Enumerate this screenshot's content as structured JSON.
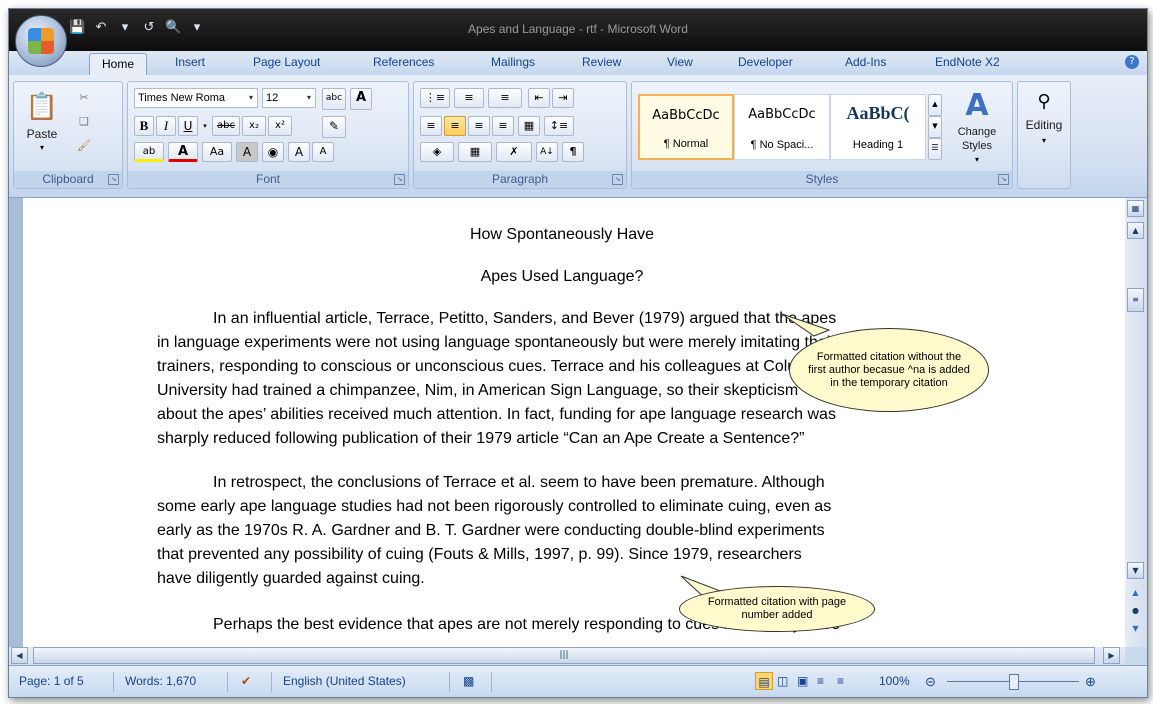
{
  "window": {
    "title": "Apes and Language - rtf - Microsoft Word",
    "quick_access_icons": [
      "save-icon",
      "undo-icon",
      "undo-dropdown-icon",
      "redo-icon",
      "print-preview-icon",
      "customize-qat-icon"
    ]
  },
  "tabs": [
    {
      "label": "Home",
      "active": true
    },
    {
      "label": "Insert"
    },
    {
      "label": "Page Layout"
    },
    {
      "label": "References"
    },
    {
      "label": "Mailings"
    },
    {
      "label": "Review"
    },
    {
      "label": "View"
    },
    {
      "label": "Developer"
    },
    {
      "label": "Add-Ins"
    },
    {
      "label": "EndNote X2"
    }
  ],
  "ribbon": {
    "clipboard": {
      "label": "Clipboard",
      "paste": "Paste"
    },
    "font": {
      "label": "Font",
      "font_name": "Times New Roma",
      "font_size": "12",
      "bold": "B",
      "italic": "I",
      "underline": "U",
      "strike": "abc",
      "subscript": "x₂",
      "superscript": "x²",
      "change_case": "Aa",
      "grow": "A",
      "shrink": "A"
    },
    "paragraph": {
      "label": "Paragraph"
    },
    "styles": {
      "label": "Styles",
      "items": [
        {
          "sample": "AaBbCcDc",
          "name": "¶ Normal"
        },
        {
          "sample": "AaBbCcDc",
          "name": "¶ No Spaci..."
        },
        {
          "sample": "AaBbC(",
          "name": "Heading 1"
        }
      ],
      "change_styles": "Change Styles"
    },
    "editing": {
      "label": "Editing"
    }
  },
  "document": {
    "title_line1": "How Spontaneously Have",
    "title_line2": "Apes Used Language?",
    "p1": [
      "In an influential article, Terrace, Petitto, Sanders, and Bever (1979) argued that the apes",
      "in language experiments were not using language spontaneously but were merely imitating their",
      "trainers, responding to conscious or unconscious cues. Terrace and his colleagues at Columbia",
      "University had trained a chimpanzee, Nim, in American Sign Language, so their skepticism",
      "about the apes’ abilities received much attention. In fact, funding for ape language research was",
      "sharply reduced following publication of their 1979 article “Can an Ape Create a Sentence?”"
    ],
    "p2": [
      "In retrospect, the conclusions of Terrace et al. seem to have been premature. Although",
      "some early ape language studies had not been rigorously controlled to eliminate cuing, even as",
      "early as the 1970s R. A. Gardner and B. T. Gardner were conducting double-blind experiments",
      "that prevented any possibility of cuing (Fouts & Mills, 1997, p. 99). Since 1979, researchers",
      "have diligently guarded against cuing."
    ],
    "p3": "Perhaps the best evidence that apes are not merely responding to cues is that they have"
  },
  "callouts": {
    "c1": "Formatted citation without the first author becasue ^na is added in the temporary citation",
    "c2": "Formatted citation with page number added"
  },
  "status": {
    "page": "Page: 1 of 5",
    "words": "Words: 1,670",
    "language": "English (United States)",
    "zoom": "100%"
  }
}
